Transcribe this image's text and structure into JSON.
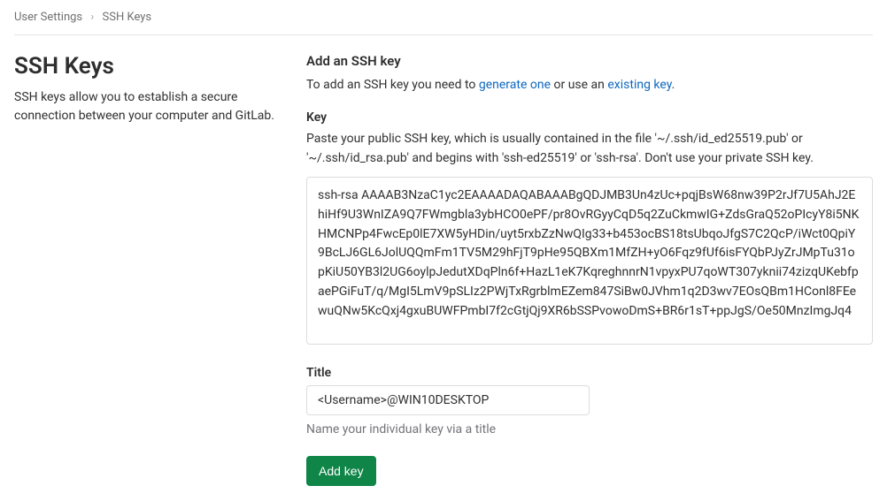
{
  "breadcrumb": {
    "parent": "User Settings",
    "current": "SSH Keys"
  },
  "left": {
    "title": "SSH Keys",
    "description": "SSH keys allow you to establish a secure connection between your computer and GitLab."
  },
  "section": {
    "heading": "Add an SSH key",
    "desc_prefix": "To add an SSH key you need to ",
    "link_generate": "generate one",
    "desc_mid": " or use an ",
    "link_existing": "existing key",
    "desc_suffix": "."
  },
  "key_field": {
    "label": "Key",
    "description": "Paste your public SSH key, which is usually contained in the file '~/.ssh/id_ed25519.pub' or '~/.ssh/id_rsa.pub' and begins with 'ssh-ed25519' or 'ssh-rsa'. Don't use your private SSH key.",
    "value": "ssh-rsa AAAAB3NzaC1yc2EAAAADAQABAAABgQDJMB3Un4zUc+pqjBsW68nw39P2rJf7U5AhJ2EhiHf9U3WnIZA9Q7FWmgbla3ybHCO0ePF/pr8OvRGyyCqD5q2ZuCkmwIG+ZdsGraQ52oPIcyY8i5NKHMCNPp4FwcEp0lE7XW5yHDin/uyt5rxbZzNwQIg33+b453ocBS18tsUbqoJfgS7C2QcP/iWct0QpiY9BcLJ6GL6JolUQQmFm1TV5M29hFjT9pHe95QBXm1MfZH+yO6Fqz9fUf6isFYQbPJyZrJMpTu31opKiU50YB3l2UG6oylpJedutXDqPln6f+HazL1eK7KqreghnnrN1vpyxPU7qoWT307yknii74zizqUKebfpaePGiFuT/q/MgI5LmV9pSLIz2PWjTxRgrblmEZem847SiBw0JVhm1q2D3wv7EOsQBm1HConl8FEewuQNw5KcQxj4gxuBUWFPmbI7f2cGtjQj9XR6bSSPvowoDmS+BR6r1sT+ppJgS/Oe50MnzImgJq4"
  },
  "title_field": {
    "label": "Title",
    "value": "<Username>@WIN10DESKTOP",
    "helper": "Name your individual key via a title"
  },
  "button": {
    "add_label": "Add key"
  }
}
